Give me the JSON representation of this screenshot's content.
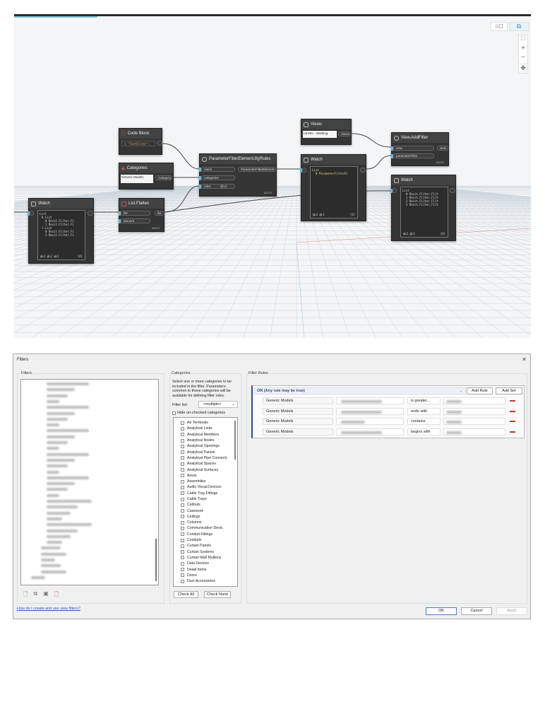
{
  "toolbar": {
    "zoom_in": "+",
    "zoom_out": "−"
  },
  "nodes": {
    "code_block": {
      "title": "Code Block",
      "code": "1 \"TextFilter\";"
    },
    "categories": {
      "title": "Categories",
      "selected": "Generic Models",
      "output": "Category"
    },
    "watch_left": {
      "title": "Watch",
      "lines": [
        "List",
        "0 List",
        "0 Revit.Filter.Fi",
        "1 Revit.Filter.Fi",
        "1 List",
        "0 Revit.Filter.Fi",
        "1 Revit.Filter.Fi"
      ],
      "footer": "@L3 @L2 @L1",
      "count": "{4}"
    },
    "list_flatten": {
      "title": "List.Flatten",
      "inputs": [
        "list",
        "amount"
      ],
      "output": "list",
      "lacing": "AUTO"
    },
    "param_filter": {
      "title": "ParameterFilterElement.ByRules",
      "inputs": [
        "name",
        "categories",
        "rules"
      ],
      "rules_value": "@L2",
      "output": "ParameterFilterElement",
      "lacing": "AUTO"
    },
    "views": {
      "title": "Views",
      "selected": "LEVEL - Working",
      "output": "Views"
    },
    "watch_mid": {
      "title": "Watch",
      "lines": [
        "List",
        "0 ParameterFilterEl"
      ],
      "footer": "@L2 @L1",
      "count": "{1}"
    },
    "view_addfilter": {
      "title": "View.AddFilter",
      "inputs": [
        "view",
        "parameterFilter"
      ],
      "output": "view",
      "lacing": "AUTO"
    },
    "watch_right": {
      "title": "Watch",
      "lines": [
        "List",
        "0 Revit.Filter.Filt",
        "1 Revit.Filter.Filt",
        "2 Revit.Filter.Filt",
        "3 Revit.Filter.Filt"
      ],
      "footer": "@L2 @L1",
      "count": "{4}"
    }
  },
  "dialog": {
    "title": "Filters",
    "close": "✕",
    "filters_label": "Filters",
    "categories": {
      "label": "Categories",
      "description": "Select one or more categories to be included in the filter.  Parameters common to these categories will be available for defining filter rules.",
      "filter_list_label": "Filter list:",
      "filter_list_value": "<multiple>",
      "hide_unchecked": "Hide un-checked categories",
      "items": [
        "Air Terminals",
        "Analytical Links",
        "Analytical Members",
        "Analytical Nodes",
        "Analytical Openings",
        "Analytical Panels",
        "Analytical Pipe Connecti.",
        "Analytical Spaces",
        "Analytical Surfaces",
        "Areas",
        "Assemblies",
        "Audio Visual Devices",
        "Cable Tray Fittings",
        "Cable Trays",
        "Callouts",
        "Casework",
        "Ceilings",
        "Columns",
        "Communication Devic.",
        "Conduit Fittings",
        "Conduits",
        "Curtain Panels",
        "Curtain Systems",
        "Curtain Wall Mullions",
        "Data Devices",
        "Detail Items",
        "Doors",
        "Duct Accessories"
      ],
      "check_all": "Check All",
      "check_none": "Check None"
    },
    "rules": {
      "label": "Filter Rules",
      "logic": "OR (Any rule may be true)",
      "add_rule": "Add Rule",
      "add_set": "Add Set",
      "rows": [
        {
          "category": "Generic Models",
          "operator": "is greater..."
        },
        {
          "category": "Generic Models",
          "operator": "ends with"
        },
        {
          "category": "Generic Models",
          "operator": "contains"
        },
        {
          "category": "Generic Models",
          "operator": "begins with"
        }
      ]
    },
    "help_link": "How do I create and use view filters?",
    "ok": "OK",
    "cancel": "Cancel",
    "apply": "Apply"
  }
}
